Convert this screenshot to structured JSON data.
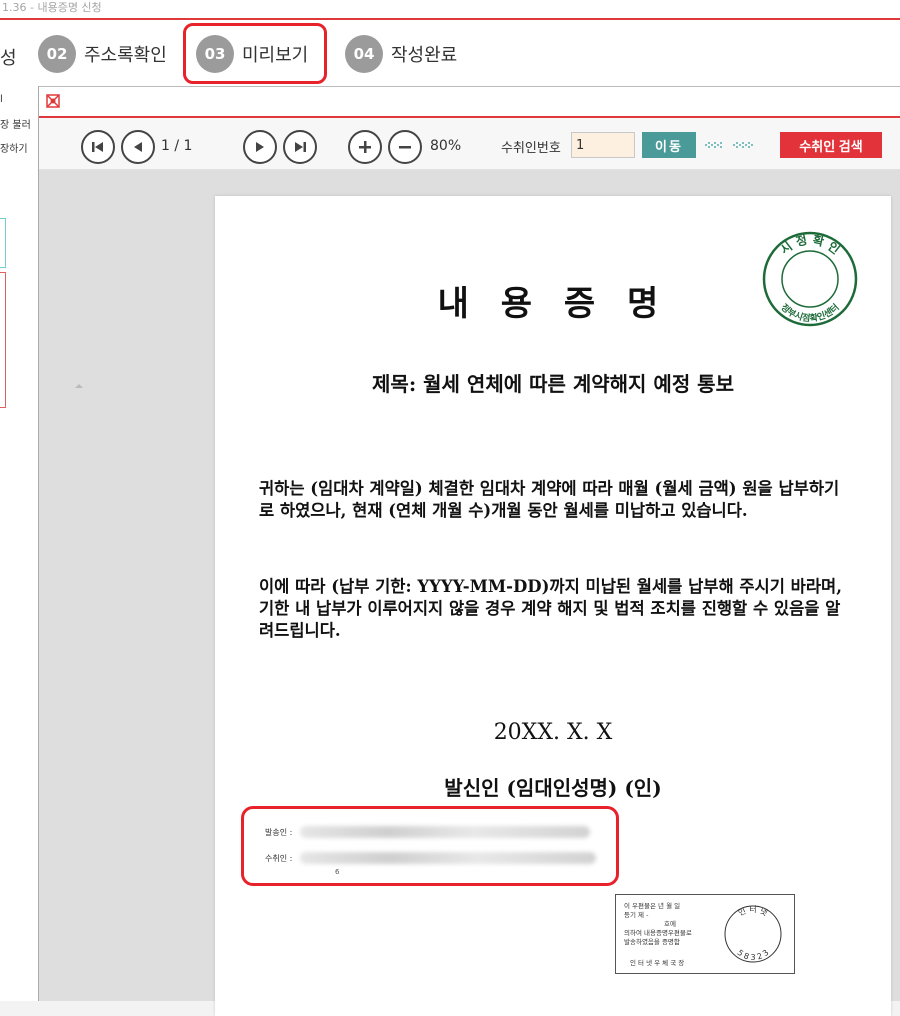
{
  "window": {
    "title": "1.36 - 내용증명 신청"
  },
  "steps": {
    "partial_label": "성",
    "items": [
      {
        "num": "02",
        "label": "주소록확인"
      },
      {
        "num": "03",
        "label": "미리보기"
      },
      {
        "num": "04",
        "label": "작성완료"
      }
    ]
  },
  "left_panel": {
    "line1": "l",
    "line2": "장 불러",
    "line3": "장하기"
  },
  "viewer_window": {
    "icon": "app-logo-icon"
  },
  "toolbar": {
    "page_indicator": "1 / 1",
    "zoom": "80%",
    "recipient_number_label": "수취인번호",
    "recipient_number_value": "1",
    "move_button": "이동",
    "search_button": "수취인 검색"
  },
  "document": {
    "title": "내 용 증 명",
    "seal": {
      "top_text": "시 정 확 인",
      "bottom_text": "정부시점확인센터"
    },
    "subject": "제목: 월세 연체에 따른 계약해지 예정 통보",
    "paragraph1": "귀하는 (임대차 계약일) 체결한 임대차 계약에 따라 매월 (월세 금액) 원을 납부하기로 하였으나, 현재 (연체 개월 수)개월 동안 월세를 미납하고 있습니다.",
    "paragraph2": " 이에 따라 (납부 기한: YYYY-MM-DD)까지 미납된 월세를 납부해 주시기 바라며, 기한 내 납부가 이루어지지 않을 경우 계약 해지 및 법적 조치를 진행할 수 있음을 알려드립니다.",
    "date": "20XX. X. X",
    "sender": "발신인 (임대인성명) (인)",
    "sender_addr_label": "발송인 :",
    "receiver_addr_label": "수취인 :",
    "receiver_addr_extra": "6",
    "postal": {
      "line1": "이 우편물은      년  월  일",
      "line2": "등기 제                  -",
      "line3": "호에",
      "line4": "의하여 내용증명우편물로",
      "line5": "발송하였음을 증명함",
      "line6": "인 터 넷 우 체 국 장",
      "circle_top": "인 터 넷",
      "circle_bottom": "5 8 3 2 3"
    }
  }
}
